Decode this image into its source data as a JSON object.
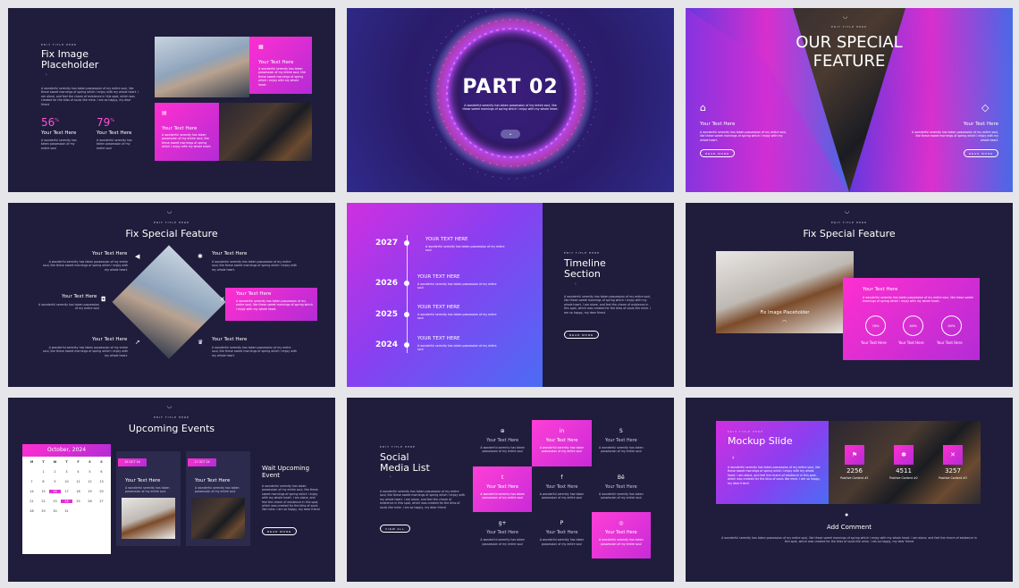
{
  "lorem_long": "A wonderful serenity has taken possession of my entire soul, like these sweet mornings of spring which I enjoy with my whole heart. I am alone, and feel the charm of existence in this spot, which was created for the bliss of souls like mine. I am so happy, my dear friend",
  "lorem_short": "A wonderful serenity has taken possession of my entire soul, like these sweet mornings of spring which I enjoy with my whole heart.",
  "lorem_tiny": "A wonderful serenity has taken possession of my entire soul",
  "edit_title": "EDIT TITLE HERE",
  "your_text": "Your Text Here",
  "your_text_upper": "YOUR TEXT HERE",
  "read_more": "READ MORE",
  "view_all": "VIEW ALL",
  "s1": {
    "title1": "Fix Image",
    "title2": "Placeholder",
    "stat1": "56",
    "stat2": "79",
    "pct": "%"
  },
  "s2": {
    "title": "PART 02",
    "text": "A wonderful serenity has taken possession of my entire soul, like these sweet mornings of spring which I enjoy with my whole heart."
  },
  "s3": {
    "title1": "OUR SPECIAL",
    "title2": "FEATURE"
  },
  "s4": {
    "title": "Fix Special Feature"
  },
  "s5": {
    "title1": "Timeline",
    "title2": "Section",
    "years": [
      "2027",
      "2026",
      "2025",
      "2024"
    ]
  },
  "s6": {
    "title": "Fix Special Feature",
    "placeholder": "Fix Image Placeholder",
    "rings": [
      "78%",
      "60%",
      "60%"
    ]
  },
  "s7": {
    "title": "Upcoming Events",
    "month": "October, 2024",
    "days": [
      "M",
      "T",
      "W",
      "T",
      "F",
      "S",
      "S"
    ],
    "cal": [
      "",
      "1",
      "2",
      "3",
      "4",
      "5",
      "6",
      "7",
      "8",
      "9",
      "10",
      "11",
      "12",
      "13",
      "14",
      "15",
      "16",
      "17",
      "18",
      "19",
      "20",
      "21",
      "22",
      "23",
      "24",
      "25",
      "26",
      "27",
      "28",
      "29",
      "30",
      "31",
      "",
      "",
      "",
      ""
    ],
    "date1": "15 OCT 16",
    "date2": "17 OCT 24",
    "wait1": "Wait Upcoming",
    "wait2": "Event"
  },
  "s8": {
    "title1": "Social",
    "title2": "Media List",
    "icons": [
      "⊕",
      "in",
      "S",
      "t",
      "f",
      "Bē",
      "g+",
      "P",
      "◎"
    ]
  },
  "s9": {
    "title": "Mockup Slide",
    "stats": [
      "2256",
      "4511",
      "3257"
    ],
    "stat_labels": [
      "Positive Content #1",
      "Positive Content #2",
      "Positive Content #3"
    ],
    "comment": "Add Comment"
  },
  "colors": {
    "bg": "#1f1d3b",
    "accent": "#ff2fd0",
    "purple": "#7b2fe0",
    "blue": "#3a63f0"
  }
}
